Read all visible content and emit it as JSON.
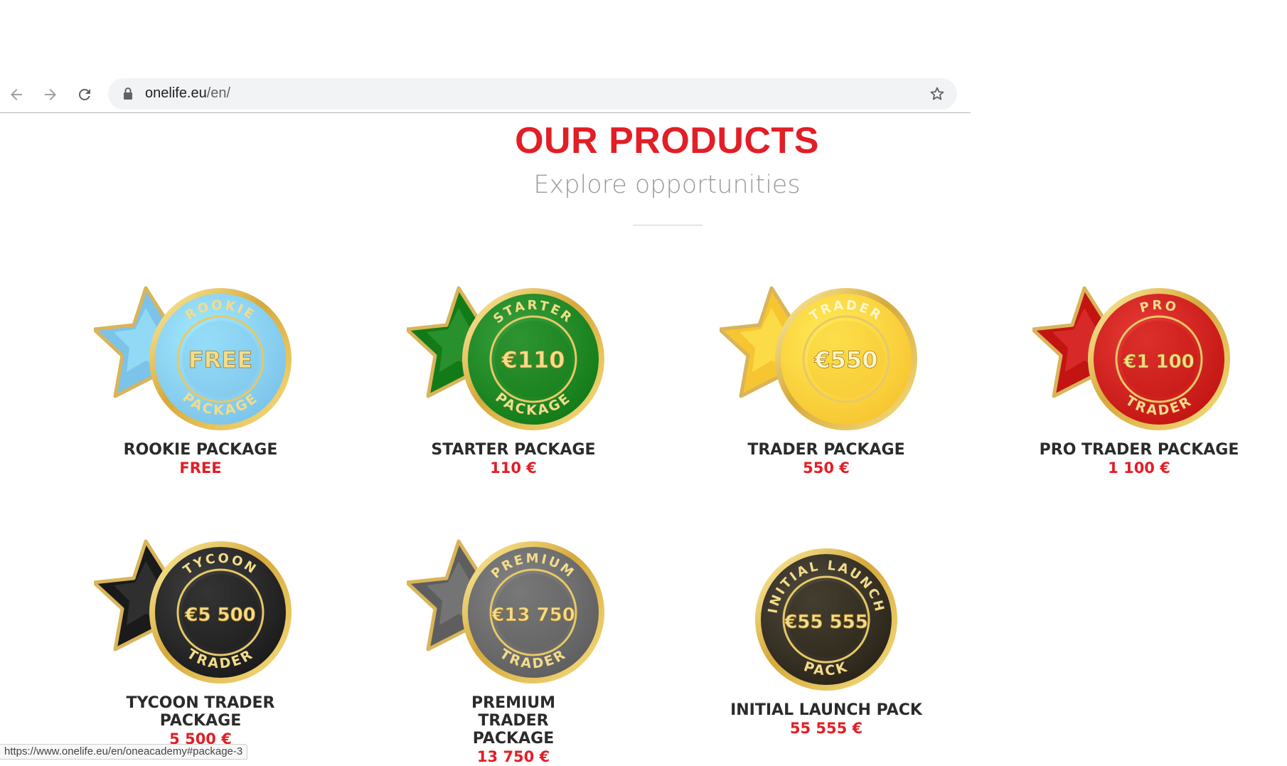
{
  "browser": {
    "url_host": "onelife.eu",
    "url_path": "/en/",
    "status_url": "https://www.onelife.eu/en/oneacademy#package-3"
  },
  "header": {
    "title": "OUR PRODUCTS",
    "subtitle": "Explore opportunities"
  },
  "colors": {
    "accent": "#e21e26"
  },
  "products": [
    {
      "name": "ROOKIE PACKAGE",
      "price": "FREE",
      "badge": {
        "top": "ROOKIE",
        "center": "FREE",
        "bottom": "PACKAGE",
        "color": "#7cc3ea"
      }
    },
    {
      "name": "STARTER PACKAGE",
      "price": "110 €",
      "badge": {
        "top": "STARTER",
        "center": "€110",
        "bottom": "PACKAGE",
        "color": "#137a18"
      }
    },
    {
      "name": "TRADER PACKAGE",
      "price": "550 €",
      "badge": {
        "top": "TRADER",
        "center": "€550",
        "bottom": "",
        "color": "#f7c531"
      }
    },
    {
      "name": "PRO TRADER PACKAGE",
      "price": "1 100 €",
      "badge": {
        "top": "PRO",
        "center": "€1 100",
        "bottom": "TRADER",
        "color": "#c21512"
      }
    },
    {
      "name": "TYCOON TRADER PACKAGE",
      "price": "5 500 €",
      "badge": {
        "top": "TYCOON",
        "center": "€5 500",
        "bottom": "TRADER",
        "color": "#1a1a1a"
      }
    },
    {
      "name": "PREMIUM TRADER PACKAGE",
      "price": "13 750 €",
      "badge": {
        "top": "PREMIUM",
        "center": "€13 750",
        "bottom": "TRADER",
        "color": "#5e5e5e"
      }
    },
    {
      "name": "INITIAL LAUNCH PACK",
      "price": "55 555 €",
      "badge": {
        "top": "INITIAL LAUNCH",
        "center": "€55 555",
        "bottom": "PACK",
        "color": "#2a2418"
      }
    }
  ]
}
